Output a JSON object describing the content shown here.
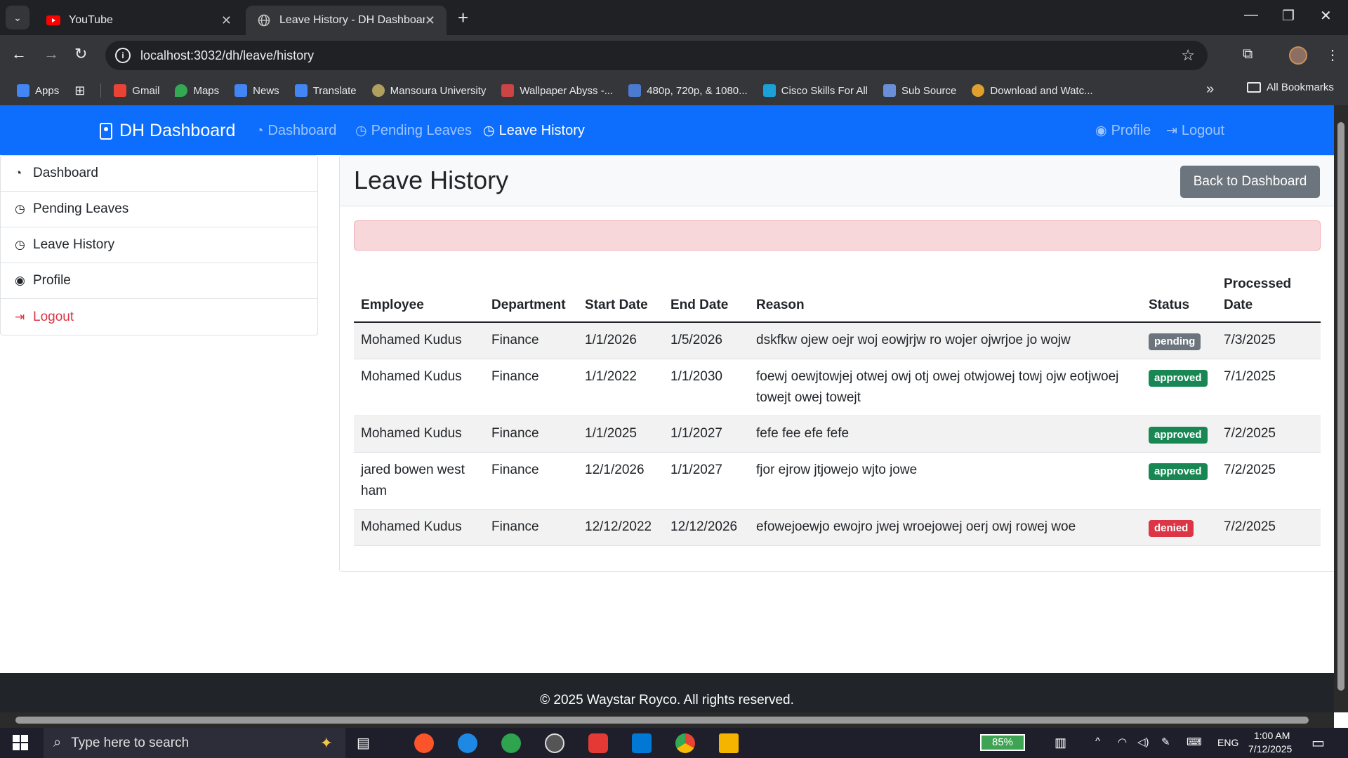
{
  "browser": {
    "tabs": [
      {
        "label": "YouTube",
        "active": false,
        "icon": "youtube-icon"
      },
      {
        "label": "Leave History - DH Dashboard",
        "active": true,
        "icon": "globe-icon"
      }
    ],
    "url": "localhost:3032/dh/leave/history",
    "bookmarks": [
      {
        "label": "Apps",
        "color": "#4285f4"
      },
      {
        "label": "Gmail",
        "color": "#ea4335"
      },
      {
        "label": "Maps",
        "color": "#34a853"
      },
      {
        "label": "News",
        "color": "#4285f4"
      },
      {
        "label": "Translate",
        "color": "#4285f4"
      },
      {
        "label": "Mansoura University",
        "color": "#b0a060"
      },
      {
        "label": "Wallpaper Abyss -...",
        "color": "#cc4444"
      },
      {
        "label": "480p, 720p, & 1080...",
        "color": "#4a7bd1"
      },
      {
        "label": "Cisco Skills For All",
        "color": "#1ba0d7"
      },
      {
        "label": "Sub Source",
        "color": "#6a8fd6"
      },
      {
        "label": "Download and Watc...",
        "color": "#e0a030"
      }
    ],
    "all_bookmarks": "All Bookmarks"
  },
  "navbar": {
    "brand": "DH Dashboard",
    "links": [
      {
        "label": "Dashboard",
        "active": false
      },
      {
        "label": "Pending Leaves",
        "active": false
      },
      {
        "label": "Leave History",
        "active": true
      }
    ],
    "right_links": [
      {
        "label": "Profile"
      },
      {
        "label": "Logout"
      }
    ]
  },
  "sidebar": {
    "items": [
      {
        "label": "Dashboard"
      },
      {
        "label": "Pending Leaves"
      },
      {
        "label": "Leave History"
      },
      {
        "label": "Profile"
      },
      {
        "label": "Logout"
      }
    ]
  },
  "main": {
    "title": "Leave History",
    "back_button": "Back to Dashboard",
    "table": {
      "headers": [
        "Employee",
        "Department",
        "Start Date",
        "End Date",
        "Reason",
        "Status",
        "Processed Date"
      ],
      "rows": [
        {
          "employee": "Mohamed Kudus",
          "department": "Finance",
          "start": "1/1/2026",
          "end": "1/5/2026",
          "reason": "dskfkw ojew oejr woj eowjrjw ro wojer ojwrjoe jo wojw",
          "status": "pending",
          "processed": "7/3/2025"
        },
        {
          "employee": "Mohamed Kudus",
          "department": "Finance",
          "start": "1/1/2022",
          "end": "1/1/2030",
          "reason": "foewj oewjtowjej otwej owj otj owej otwjowej towj ojw eotjwoej towejt owej towejt",
          "status": "approved",
          "processed": "7/1/2025"
        },
        {
          "employee": "Mohamed Kudus",
          "department": "Finance",
          "start": "1/1/2025",
          "end": "1/1/2027",
          "reason": "fefe fee efe fefe",
          "status": "approved",
          "processed": "7/2/2025"
        },
        {
          "employee": "jared bowen west ham",
          "department": "Finance",
          "start": "12/1/2026",
          "end": "1/1/2027",
          "reason": "fjor ejrow jtjowejo wjto jowe",
          "status": "approved",
          "processed": "7/2/2025"
        },
        {
          "employee": "Mohamed Kudus",
          "department": "Finance",
          "start": "12/12/2022",
          "end": "12/12/2026",
          "reason": "efowejoewjo ewojro jwej wroejowej oerj owj rowej woe",
          "status": "denied",
          "processed": "7/2/2025"
        }
      ]
    },
    "status_colors": {
      "pending": "#6c757d",
      "approved": "#198754",
      "denied": "#dc3545"
    }
  },
  "footer": {
    "text": "© 2025 Waystar Royco. All rights reserved."
  },
  "taskbar": {
    "search_placeholder": "Type here to search",
    "battery": "85%",
    "language": "ENG",
    "time": "1:00 AM",
    "date": "7/12/2025"
  },
  "colors": {
    "primary": "#0d6efd",
    "secondary": "#6c757d",
    "danger": "#dc3545",
    "alert_bg": "#f8d7da"
  }
}
